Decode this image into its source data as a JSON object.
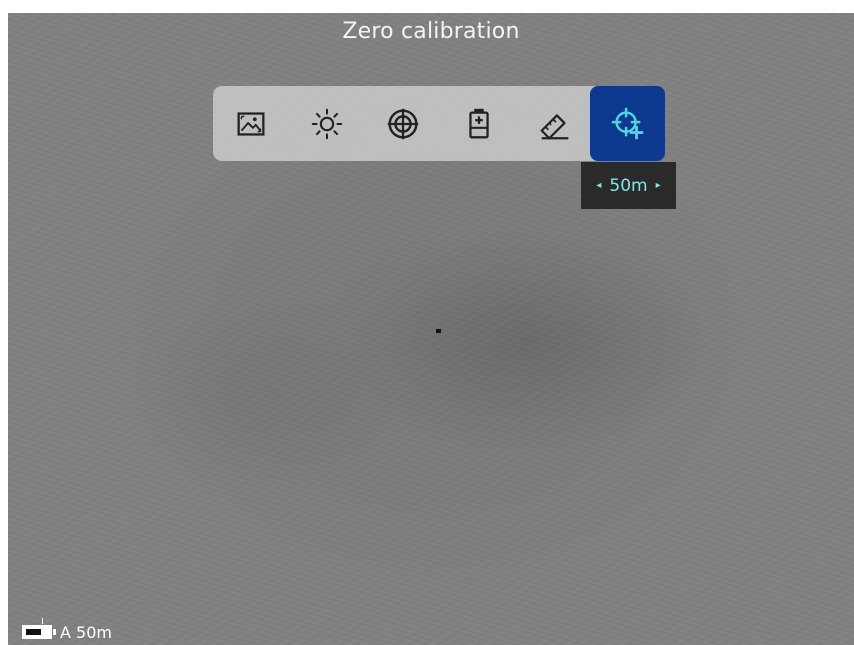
{
  "title": "Zero calibration",
  "menu": {
    "items": [
      {
        "name": "image-mode-icon",
        "active": false
      },
      {
        "name": "brightness-icon",
        "active": false
      },
      {
        "name": "reticle-icon",
        "active": false
      },
      {
        "name": "battery-plus-icon",
        "active": false
      },
      {
        "name": "ruler-icon",
        "active": false
      },
      {
        "name": "crosshair-plus-icon",
        "active": true
      }
    ],
    "active_color": "#0d3a8f",
    "accent_color": "#4fd4e0"
  },
  "zero_value": {
    "value": "50m",
    "left_arrow": "◂",
    "right_arrow": "▸"
  },
  "status": {
    "mode_distance": "A 50m"
  }
}
